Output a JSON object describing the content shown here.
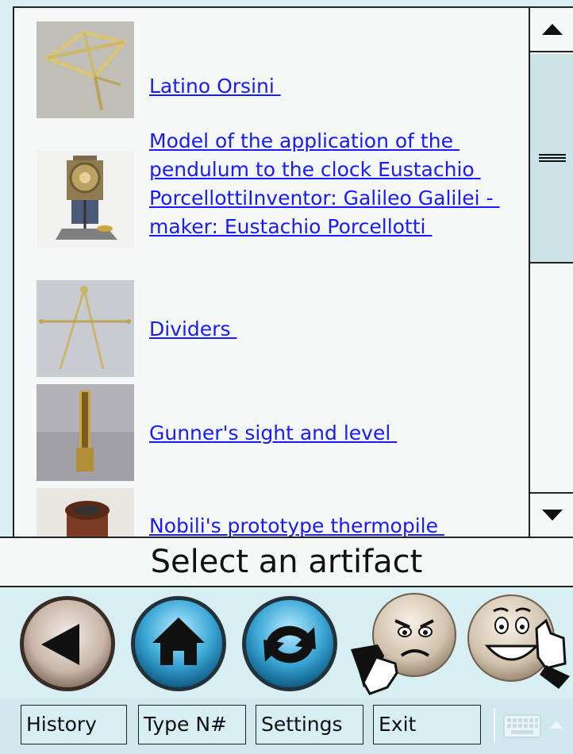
{
  "artifacts": [
    {
      "title": "Latino Orsini ",
      "thumb_icon": "sector-instrument-icon"
    },
    {
      "title": "Model of the application of the pendulum to the clock Eustachio PorcellottiInventor: Galileo Galilei - maker: Eustachio Porcellotti ",
      "thumb_icon": "pendulum-clock-icon"
    },
    {
      "title": "Dividers ",
      "thumb_icon": "dividers-icon"
    },
    {
      "title": "Gunner's sight and level ",
      "thumb_icon": "gunners-sight-icon"
    },
    {
      "title": "Nobili's prototype thermopile ",
      "thumb_icon": "thermopile-icon"
    }
  ],
  "status": {
    "text": "Select an artifact"
  },
  "toolbar": {
    "back_icon": "back-arrow-icon",
    "home_icon": "home-icon",
    "refresh_icon": "refresh-icon",
    "dislike_icon": "thumbs-down-face-icon",
    "like_icon": "thumbs-up-face-icon"
  },
  "menu": {
    "history_label": "History",
    "typeno_label": "Type N#",
    "settings_label": "Settings",
    "exit_label": "Exit"
  },
  "colors": {
    "link": "#1a1aff",
    "background": "#d7eef3",
    "panel": "#f4f9f8",
    "scroll_thumb": "#c9e3e6",
    "home_button": "#3aa6d6",
    "round_button_grey": "#b9a89a"
  }
}
